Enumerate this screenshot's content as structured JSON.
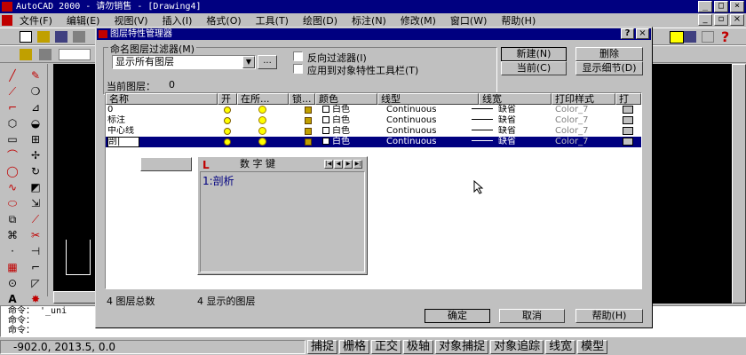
{
  "app": {
    "title": "AutoCAD 2000 - 请勿销售 - [Drawing4]",
    "menu": [
      "文件(F)",
      "编辑(E)",
      "视图(V)",
      "插入(I)",
      "格式(O)",
      "工具(T)",
      "绘图(D)",
      "标注(N)",
      "修改(M)",
      "窗口(W)",
      "帮助(H)"
    ]
  },
  "dialog": {
    "title": "图层特性管理器",
    "filter_group_label": "命名图层过滤器(M)",
    "filter_value": "显示所有图层",
    "filter_dots": "...",
    "invert_filter_label": "反向过滤器(I)",
    "apply_toolbar_label": "应用到对象特性工具栏(T)",
    "buttons": {
      "new": "新建(N)",
      "delete": "删除",
      "current": "当前(C)",
      "details": "显示细节(D)",
      "ok": "确定",
      "cancel": "取消",
      "help": "帮助(H)"
    },
    "current_layer_label": "当前图层：",
    "current_layer_value": "0",
    "columns": [
      "名称",
      "开",
      "在所...",
      "锁...",
      "颜色",
      "线型",
      "线宽",
      "打印样式",
      "打"
    ],
    "rows": [
      {
        "name": "0",
        "color": "白色",
        "linetype": "Continuous",
        "lineweight": "缺省",
        "plotstyle": "Color_7"
      },
      {
        "name": "标注",
        "color": "白色",
        "linetype": "Continuous",
        "lineweight": "缺省",
        "plotstyle": "Color_7"
      },
      {
        "name": "中心线",
        "color": "白色",
        "linetype": "Continuous",
        "lineweight": "缺省",
        "plotstyle": "Color_7"
      },
      {
        "name": "剖|",
        "color": "白色",
        "linetype": "Continuous",
        "lineweight": "缺省",
        "plotstyle": "Color_7"
      }
    ],
    "total_layers": "4 图层总数",
    "shown_layers": "4 显示的图层"
  },
  "numpad": {
    "title": "数 字 键",
    "entry": "1:剖析"
  },
  "command": {
    "lines": [
      "命令： '_uni",
      "命令：",
      "命令："
    ]
  },
  "status": {
    "coords": "-902.0, 2013.5, 0.0",
    "buttons": [
      "捕捉",
      "栅格",
      "正交",
      "极轴",
      "对象捕捉",
      "对象追踪",
      "线宽",
      "模型"
    ]
  }
}
